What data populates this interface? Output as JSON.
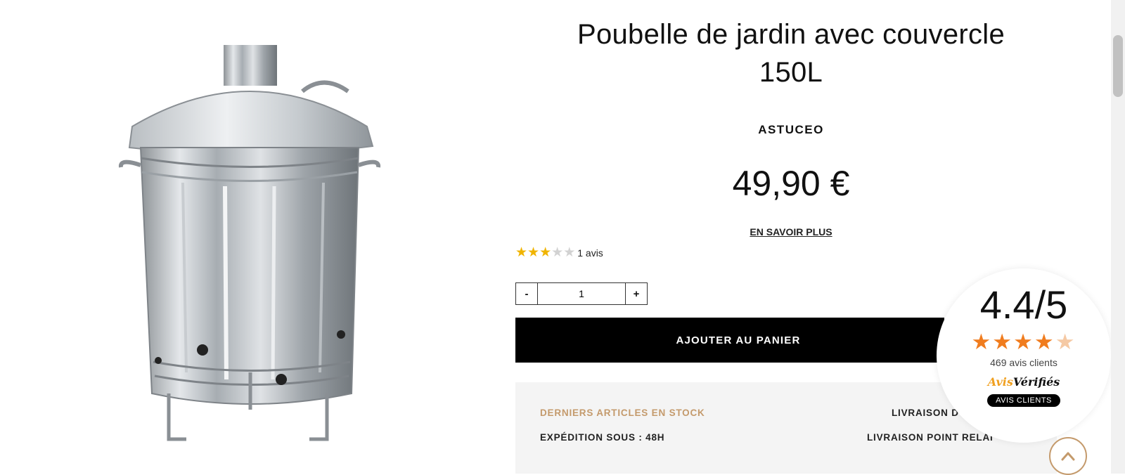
{
  "product": {
    "title_line1": "Poubelle de jardin avec couvercle",
    "title_line2": "150L",
    "brand": "ASTUCEO",
    "price": "49,90 €",
    "learn_more": "EN SAVOIR PLUS",
    "image_icon": "galvanized-bin-image"
  },
  "rating": {
    "value": 3,
    "max": 5,
    "count_label": "1 avis"
  },
  "quantity": {
    "minus": "-",
    "value": "1",
    "plus": "+"
  },
  "cart": {
    "add_label": "AJOUTER AU PANIER"
  },
  "info": {
    "stock": "DERNIERS ARTICLES EN STOCK",
    "shipping": "EXPÉDITION SOUS : 48H",
    "home_delivery": "LIVRAISON D",
    "relay_delivery": "LIVRAISON POINT RELAI"
  },
  "reviews_badge": {
    "score": "4.4/5",
    "stars_value": 4.4,
    "count": "469 avis clients",
    "logo_part1": "Avis",
    "logo_part2": "Vérifiés",
    "pill": "AVIS CLIENTS"
  },
  "colors": {
    "star": "#f0b400",
    "accent": "#c49a6c",
    "badge_star": "#f07c1e"
  },
  "scroll_top_icon": "chevron-up-icon"
}
